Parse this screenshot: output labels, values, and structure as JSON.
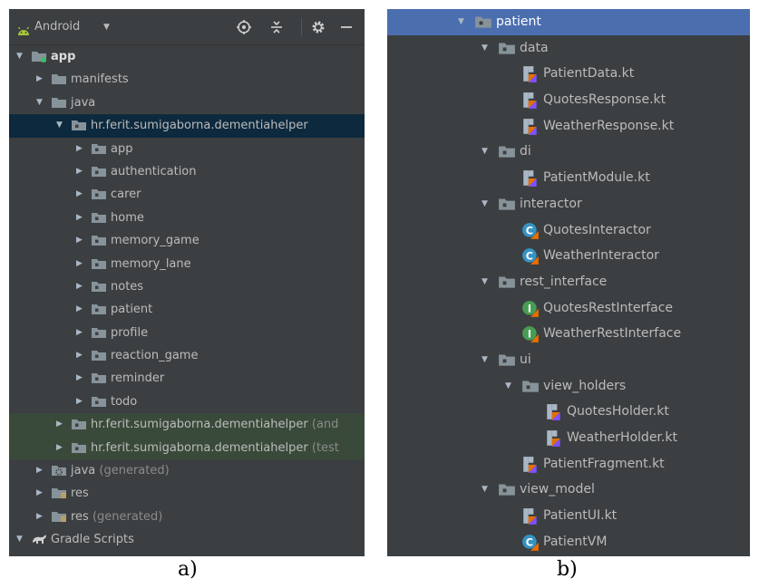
{
  "panel_a": {
    "header": {
      "title": "Android"
    },
    "tree": [
      {
        "label": "app",
        "level": 0,
        "expanded": true,
        "icon": "module-folder-icon",
        "bold": true,
        "suffix": ""
      },
      {
        "label": "manifests",
        "level": 1,
        "expanded": false,
        "icon": "folder-icon",
        "suffix": ""
      },
      {
        "label": "java",
        "level": 1,
        "expanded": true,
        "icon": "folder-icon",
        "suffix": ""
      },
      {
        "label": "hr.ferit.sumigaborna.dementiahelper",
        "level": 2,
        "expanded": true,
        "icon": "package-icon",
        "selected": "blue",
        "suffix": ""
      },
      {
        "label": "app",
        "level": 3,
        "expanded": false,
        "icon": "package-icon",
        "suffix": ""
      },
      {
        "label": "authentication",
        "level": 3,
        "expanded": false,
        "icon": "package-icon",
        "suffix": ""
      },
      {
        "label": "carer",
        "level": 3,
        "expanded": false,
        "icon": "package-icon",
        "suffix": ""
      },
      {
        "label": "home",
        "level": 3,
        "expanded": false,
        "icon": "package-icon",
        "suffix": ""
      },
      {
        "label": "memory_game",
        "level": 3,
        "expanded": false,
        "icon": "package-icon",
        "suffix": ""
      },
      {
        "label": "memory_lane",
        "level": 3,
        "expanded": false,
        "icon": "package-icon",
        "suffix": ""
      },
      {
        "label": "notes",
        "level": 3,
        "expanded": false,
        "icon": "package-icon",
        "suffix": ""
      },
      {
        "label": "patient",
        "level": 3,
        "expanded": false,
        "icon": "package-icon",
        "suffix": ""
      },
      {
        "label": "profile",
        "level": 3,
        "expanded": false,
        "icon": "package-icon",
        "suffix": ""
      },
      {
        "label": "reaction_game",
        "level": 3,
        "expanded": false,
        "icon": "package-icon",
        "suffix": ""
      },
      {
        "label": "reminder",
        "level": 3,
        "expanded": false,
        "icon": "package-icon",
        "suffix": ""
      },
      {
        "label": "todo",
        "level": 3,
        "expanded": false,
        "icon": "package-icon",
        "suffix": ""
      },
      {
        "label": "hr.ferit.sumigaborna.dementiahelper",
        "level": 2,
        "expanded": false,
        "icon": "package-icon",
        "selected": "green",
        "suffix": "(and"
      },
      {
        "label": "hr.ferit.sumigaborna.dementiahelper",
        "level": 2,
        "expanded": false,
        "icon": "package-icon",
        "selected": "green",
        "suffix": "(test"
      },
      {
        "label": "java",
        "level": 1,
        "expanded": false,
        "icon": "generated-folder-icon",
        "suffix": "(generated)"
      },
      {
        "label": "res",
        "level": 1,
        "expanded": false,
        "icon": "resource-folder-icon",
        "suffix": ""
      },
      {
        "label": "res",
        "level": 1,
        "expanded": false,
        "icon": "resource-folder-icon",
        "suffix": "(generated)"
      },
      {
        "label": "Gradle Scripts",
        "level": 0,
        "expanded": true,
        "icon": "gradle-icon",
        "suffix": ""
      }
    ],
    "caption": "a)"
  },
  "panel_b": {
    "tree": [
      {
        "label": "patient",
        "level": 0,
        "expanded": true,
        "icon": "package-icon",
        "selected": "light"
      },
      {
        "label": "data",
        "level": 1,
        "expanded": true,
        "icon": "package-icon"
      },
      {
        "label": "PatientData.kt",
        "level": 2,
        "icon": "kotlin-file-icon"
      },
      {
        "label": "QuotesResponse.kt",
        "level": 2,
        "icon": "kotlin-file-icon"
      },
      {
        "label": "WeatherResponse.kt",
        "level": 2,
        "icon": "kotlin-file-icon"
      },
      {
        "label": "di",
        "level": 1,
        "expanded": true,
        "icon": "package-icon"
      },
      {
        "label": "PatientModule.kt",
        "level": 2,
        "icon": "kotlin-file-icon"
      },
      {
        "label": "interactor",
        "level": 1,
        "expanded": true,
        "icon": "package-icon"
      },
      {
        "label": "QuotesInteractor",
        "level": 2,
        "icon": "kotlin-class-icon"
      },
      {
        "label": "WeatherInteractor",
        "level": 2,
        "icon": "kotlin-class-icon"
      },
      {
        "label": "rest_interface",
        "level": 1,
        "expanded": true,
        "icon": "package-icon"
      },
      {
        "label": "QuotesRestInterface",
        "level": 2,
        "icon": "kotlin-interface-icon"
      },
      {
        "label": "WeatherRestInterface",
        "level": 2,
        "icon": "kotlin-interface-icon"
      },
      {
        "label": "ui",
        "level": 1,
        "expanded": true,
        "icon": "package-icon"
      },
      {
        "label": "view_holders",
        "level": 2,
        "expanded": true,
        "icon": "package-icon"
      },
      {
        "label": "QuotesHolder.kt",
        "level": 3,
        "icon": "kotlin-file-icon"
      },
      {
        "label": "WeatherHolder.kt",
        "level": 3,
        "icon": "kotlin-file-icon"
      },
      {
        "label": "PatientFragment.kt",
        "level": 2,
        "icon": "kotlin-file-icon"
      },
      {
        "label": "view_model",
        "level": 1,
        "expanded": true,
        "icon": "package-icon"
      },
      {
        "label": "PatientUI.kt",
        "level": 2,
        "icon": "kotlin-file-icon"
      },
      {
        "label": "PatientVM",
        "level": 2,
        "icon": "kotlin-class-icon"
      }
    ],
    "caption": "b)"
  },
  "colors": {
    "panel_bg": "#3c3f41",
    "selection_blue": "#0d293e",
    "selection_green": "#3a4a3a",
    "selection_light": "#4b6eaf",
    "folder": "#87939a",
    "text": "#bbbbbb"
  }
}
